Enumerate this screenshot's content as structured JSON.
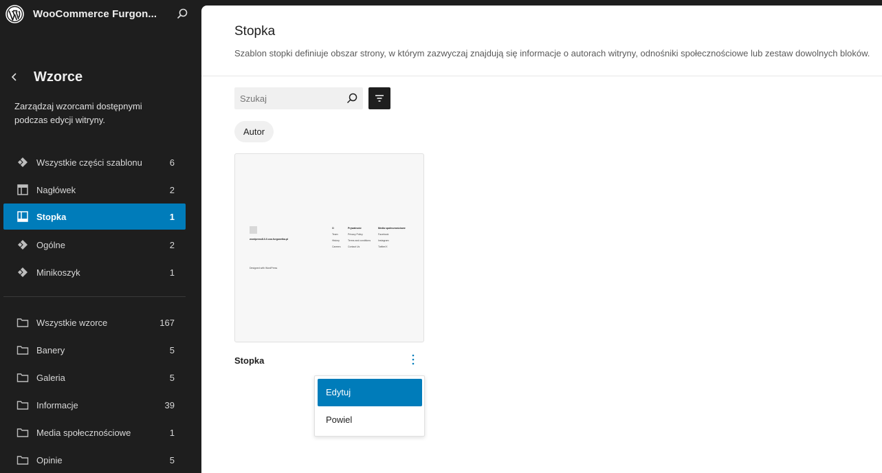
{
  "app": {
    "site_title": "WooCommerce Furgon...",
    "logo_icon": "wordpress-logo-icon",
    "search_icon": "search-icon"
  },
  "sidebar": {
    "section_title": "Wzorce",
    "description": "Zarządzaj wzorcami dostępnymi podczas edycji witryny.",
    "template_parts": [
      {
        "label": "Wszystkie części szablonu",
        "count": "6",
        "icon": "symbol-filled-icon",
        "active": false
      },
      {
        "label": "Nagłówek",
        "count": "2",
        "icon": "header-icon",
        "active": false
      },
      {
        "label": "Stopka",
        "count": "1",
        "icon": "footer-icon",
        "active": true
      },
      {
        "label": "Ogólne",
        "count": "2",
        "icon": "symbol-filled-icon",
        "active": false
      },
      {
        "label": "Minikoszyk",
        "count": "1",
        "icon": "symbol-filled-icon",
        "active": false
      }
    ],
    "categories": [
      {
        "label": "Wszystkie wzorce",
        "count": "167",
        "icon": "folder-icon"
      },
      {
        "label": "Banery",
        "count": "5",
        "icon": "folder-icon"
      },
      {
        "label": "Galeria",
        "count": "5",
        "icon": "folder-icon"
      },
      {
        "label": "Informacje",
        "count": "39",
        "icon": "folder-icon"
      },
      {
        "label": "Media społecznościowe",
        "count": "1",
        "icon": "folder-icon"
      },
      {
        "label": "Opinie",
        "count": "5",
        "icon": "folder-icon"
      }
    ]
  },
  "main": {
    "title": "Stopka",
    "description": "Szablon stopki definiuje obszar strony, w którym zazwyczaj znajdują się informacje o autorach witryny, odnośniki społecznościowe lub zestaw dowolnych bloków.",
    "search": {
      "placeholder": "Szukaj",
      "value": ""
    },
    "filter_chip": "Autor",
    "card": {
      "name": "Stopka",
      "preview": {
        "site_name": "wordpress8-0-0.coo.furgonetka.pl",
        "col1_head": "O",
        "col1": [
          "Team",
          "History",
          "Careers"
        ],
        "col2_head": "Prywatność",
        "col2": [
          "Privacy Policy",
          "Terms and conditions",
          "Contact Us"
        ],
        "col3_head": "Media społecznościowe",
        "col3": [
          "Facebook",
          "Instagram",
          "Twitter/X"
        ],
        "credit": "Designed with WordPress"
      }
    },
    "context_menu": {
      "edit": "Edytuj",
      "duplicate": "Powiel"
    }
  },
  "colors": {
    "accent": "#007cba",
    "sidebar_bg": "#1e1e1e"
  }
}
